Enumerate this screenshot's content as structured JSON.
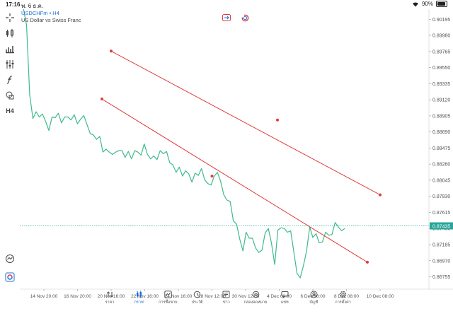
{
  "status_bar": {
    "time": "17:16",
    "date": "พ. 6 ธ.ค.",
    "battery": "90%",
    "battery_level": 0.9
  },
  "symbol": {
    "name": "USDCHFm • H4",
    "description": "US Dollar vs Swiss Franc"
  },
  "left_toolbar": {
    "timeframe_label": "H4",
    "icons": [
      "crosshair-icon",
      "candlestick-icon",
      "bar-chart-icon",
      "indicators-icon",
      "function-icon",
      "objects-icon",
      "timeframe-h4"
    ]
  },
  "colors": {
    "line": "#3dbb8a",
    "trendline": "#e03c3c",
    "price_line": "#26a69a",
    "accent": "#1a6ed8"
  },
  "chart_data": {
    "type": "line",
    "symbol": "USDCHFm",
    "timeframe": "H4",
    "current_price": "0.87435",
    "price_axis": [
      "0.90195",
      "0.89980",
      "0.89765",
      "0.89550",
      "0.89335",
      "0.89120",
      "0.88905",
      "0.88690",
      "0.88475",
      "0.88260",
      "0.88045",
      "0.87830",
      "0.87615",
      "0.87400",
      "0.87185",
      "0.86970",
      "0.86755"
    ],
    "ylim": [
      0.8659,
      0.9033
    ],
    "time_axis": [
      "14 Nov 20:00",
      "16 Nov 20:00",
      "20 Nov 16:00",
      "22 Nov 16:00",
      "24 Nov 16:00",
      "28 Nov 12:00",
      "30 Nov 12:00",
      "4 Dec 08:00",
      "6 Dec 08:00",
      "8 Dec 08:00",
      "10 Dec 08:00"
    ],
    "series": [
      {
        "values": [
          0.9034,
          0.9012,
          0.8918,
          0.8887,
          0.8896,
          0.8889,
          0.8893,
          0.8883,
          0.8871,
          0.8889,
          0.8888,
          0.8894,
          0.8881,
          0.8889,
          0.8889,
          0.8885,
          0.8892,
          0.888,
          0.8886,
          0.8891,
          0.8879,
          0.8867,
          0.8865,
          0.8859,
          0.8863,
          0.8842,
          0.8846,
          0.8842,
          0.8839,
          0.8842,
          0.8844,
          0.8844,
          0.8835,
          0.8843,
          0.8833,
          0.8844,
          0.8842,
          0.8838,
          0.8853,
          0.8839,
          0.8833,
          0.8837,
          0.8832,
          0.8844,
          0.884,
          0.8843,
          0.8828,
          0.8825,
          0.8815,
          0.8822,
          0.881,
          0.8817,
          0.8813,
          0.8802,
          0.8814,
          0.8811,
          0.882,
          0.8805,
          0.88,
          0.8798,
          0.881,
          0.8815,
          0.8803,
          0.8785,
          0.8778,
          0.8776,
          0.875,
          0.8746,
          0.8726,
          0.871,
          0.8735,
          0.8727,
          0.8727,
          0.8714,
          0.8708,
          0.8711,
          0.8734,
          0.874,
          0.872,
          0.8692,
          0.8738,
          0.8741,
          0.874,
          0.8735,
          0.8737,
          0.8709,
          0.868,
          0.8674,
          0.869,
          0.871,
          0.8742,
          0.8728,
          0.8733,
          0.8721,
          0.8722,
          0.8735,
          0.8731,
          0.8732,
          0.8748,
          0.8742,
          0.8737,
          0.874
        ]
      }
    ],
    "trendlines": [
      {
        "points": [
          [
            0.8977,
            "20 Nov 16:00"
          ],
          [
            0.8885,
            "1 Dec"
          ],
          [
            0.8785,
            "10 Dec 08:00"
          ]
        ]
      },
      {
        "points": [
          [
            0.8913,
            "19 Nov"
          ],
          [
            0.881,
            "28 Nov 12:00"
          ],
          [
            0.8695,
            "7 Dec"
          ]
        ]
      }
    ]
  },
  "top_buttons": [
    "switch-chart-icon",
    "refresh-icon"
  ],
  "tab_bar": {
    "active": 1,
    "tabs": [
      {
        "label": "ราคา",
        "icon": "arrows-updown-icon"
      },
      {
        "label": "กราฟ",
        "icon": "candlestick-icon"
      },
      {
        "label": "การซื้อขาย",
        "icon": "trade-chart-icon"
      },
      {
        "label": "ประวัติ",
        "icon": "history-icon"
      },
      {
        "label": "ข่าว",
        "icon": "news-icon"
      },
      {
        "label": "กล่องจดหมาย",
        "icon": "mailbox-icon"
      },
      {
        "label": "แชท",
        "icon": "chat-icon"
      },
      {
        "label": "บัญชี",
        "icon": "account-icon"
      },
      {
        "label": "การตั้งค่า",
        "icon": "settings-icon"
      }
    ]
  }
}
